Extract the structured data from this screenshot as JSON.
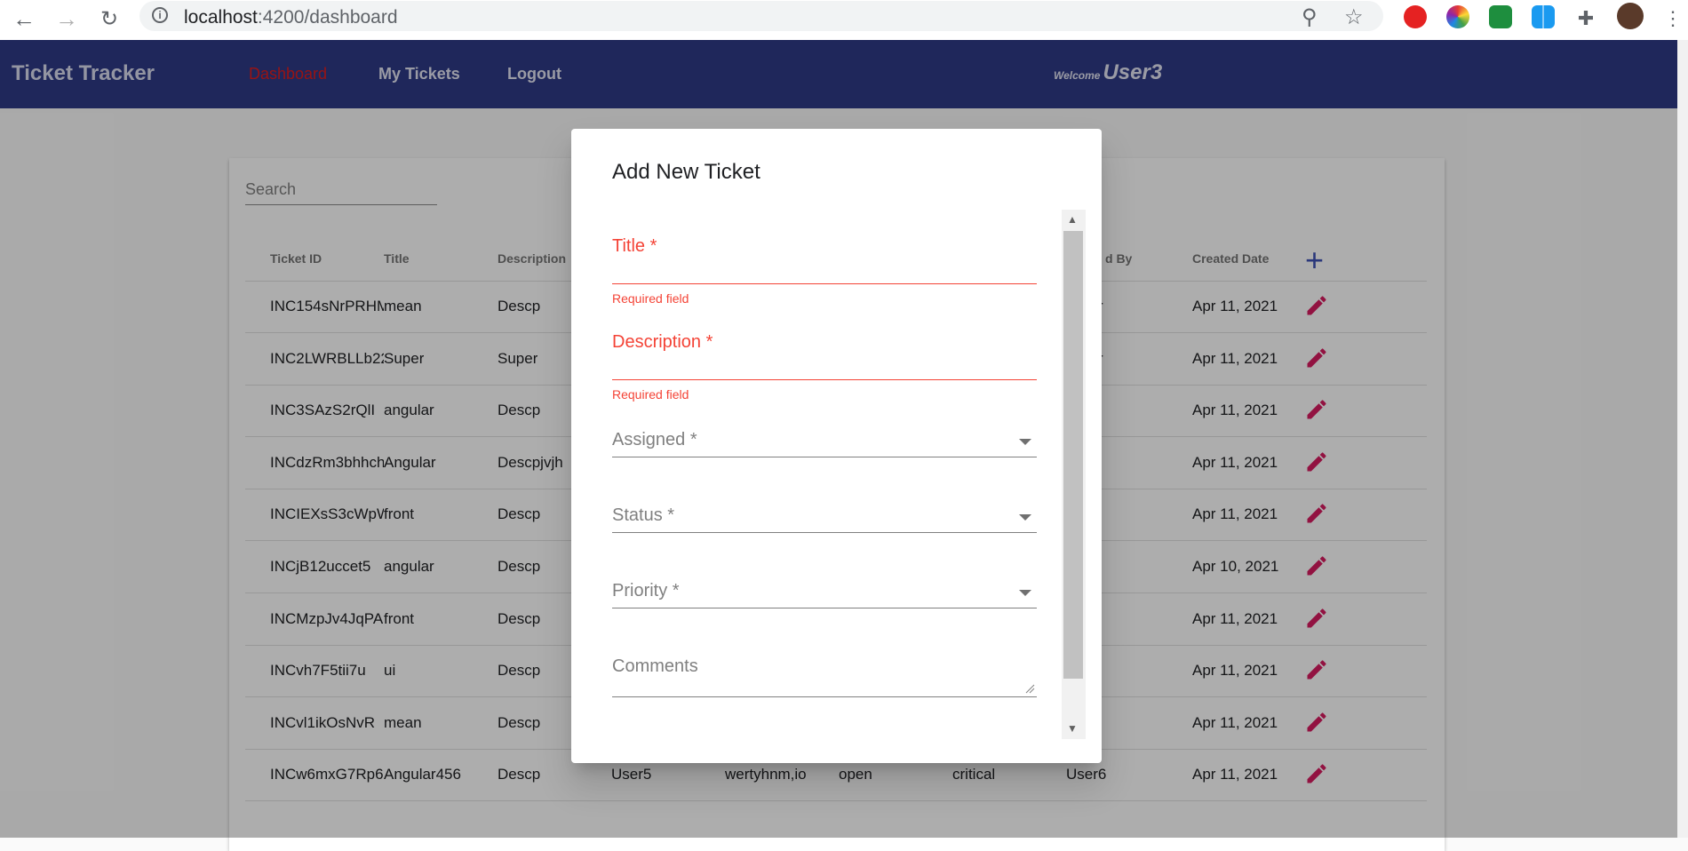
{
  "browser": {
    "url_host": "localhost",
    "url_path": ":4200/dashboard"
  },
  "toolbar": {
    "brand": "Ticket Tracker",
    "nav": [
      "Dashboard",
      "My Tickets",
      "Logout"
    ],
    "active_nav": "Dashboard",
    "welcome_label": "Welcome",
    "user": "User3",
    "color": "#2f3a87"
  },
  "table": {
    "search_placeholder": "Search",
    "headers": [
      "Ticket ID",
      "Title",
      "Description",
      "",
      "",
      "",
      "",
      "d By",
      "Created Date"
    ],
    "rows": [
      {
        "id": "INC154sNrPRHM",
        "title": "mean",
        "desc": "Descp",
        "assigned": "",
        "comments": "",
        "status": "",
        "priority": "",
        "created_by": "-User",
        "date": "Apr 11, 2021"
      },
      {
        "id": "INC2LWRBLLb22",
        "title": "Super",
        "desc": "Super",
        "assigned": "",
        "comments": "",
        "status": "",
        "priority": "",
        "created_by": "-User",
        "date": "Apr 11, 2021"
      },
      {
        "id": "INC3SAzS2rQlI",
        "title": "angular",
        "desc": "Descp",
        "assigned": "",
        "comments": "",
        "status": "",
        "priority": "",
        "created_by": "n",
        "date": "Apr 11, 2021"
      },
      {
        "id": "INCdzRm3bhhch",
        "title": "Angular",
        "desc": "Descpjvjh",
        "assigned": "",
        "comments": "",
        "status": "",
        "priority": "",
        "created_by": "",
        "date": "Apr 11, 2021"
      },
      {
        "id": "INCIEXsS3cWpW",
        "title": "front",
        "desc": "Descp",
        "assigned": "",
        "comments": "",
        "status": "",
        "priority": "",
        "created_by": "",
        "date": "Apr 11, 2021"
      },
      {
        "id": "INCjB12uccet5",
        "title": "angular",
        "desc": "Descp",
        "assigned": "",
        "comments": "",
        "status": "",
        "priority": "",
        "created_by": "n",
        "date": "Apr 10, 2021"
      },
      {
        "id": "INCMzpJv4JqPA",
        "title": "front",
        "desc": "Descp",
        "assigned": "",
        "comments": "",
        "status": "",
        "priority": "",
        "created_by": "",
        "date": "Apr 11, 2021"
      },
      {
        "id": "INCvh7F5tii7u",
        "title": "ui",
        "desc": "Descp",
        "assigned": "",
        "comments": "",
        "status": "",
        "priority": "",
        "created_by": "",
        "date": "Apr 11, 2021"
      },
      {
        "id": "INCvl1ikOsNvR",
        "title": "mean",
        "desc": "Descp",
        "assigned": "",
        "comments": "",
        "status": "",
        "priority": "",
        "created_by": "",
        "date": "Apr 11, 2021"
      },
      {
        "id": "INCw6mxG7Rp6c",
        "title": "Angular456",
        "desc": "Descp",
        "assigned": "User5",
        "comments": "wertyhnm,io",
        "status": "open",
        "priority": "critical",
        "created_by": "User6",
        "date": "Apr 11, 2021"
      }
    ],
    "accent": "#3f51b5",
    "edit_color": "#d81b60"
  },
  "dialog": {
    "title": "Add New Ticket",
    "fields": {
      "title": {
        "label": "Title *",
        "error": "Required field"
      },
      "description": {
        "label": "Description *",
        "error": "Required field"
      },
      "assigned": {
        "label": "Assigned *"
      },
      "status": {
        "label": "Status *"
      },
      "priority": {
        "label": "Priority *"
      },
      "comments": {
        "label": "Comments"
      }
    },
    "error_color": "#f44336"
  }
}
